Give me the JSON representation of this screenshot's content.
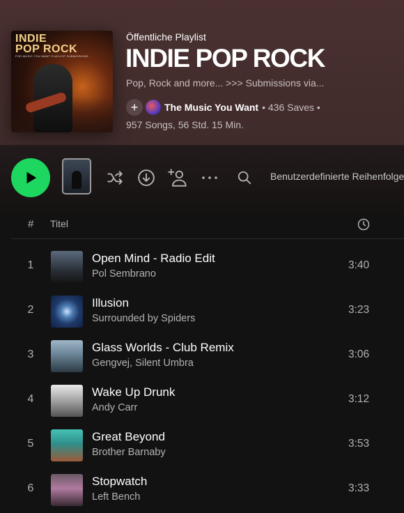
{
  "playlist": {
    "type_label": "Öffentliche Playlist",
    "title": "INDIE POP ROCK",
    "description": "Pop, Rock and more... >>> Submissions via...",
    "owner": "The Music You Want",
    "saves": "• 436 Saves •",
    "duration": "957 Songs, 56 Std. 15 Min.",
    "cover_text": "INDIE\nPOP ROCK",
    "cover_subtitle": "FOR MUSIC YOU WANT PLAYLIST SUBMISSIONS"
  },
  "actions": {
    "sort_label": "Benutzerdefinierte Reihenfolge",
    "icons": [
      "play-icon",
      "shuffle-icon",
      "download-icon",
      "add-user-icon",
      "more-icon",
      "search-icon"
    ]
  },
  "table": {
    "col_number": "#",
    "col_title": "Titel",
    "tracks": [
      {
        "num": "1",
        "title": "Open Mind - Radio Edit",
        "artist": "Pol Sembrano",
        "time": "3:40"
      },
      {
        "num": "2",
        "title": "Illusion",
        "artist": "Surrounded by Spiders",
        "time": "3:23"
      },
      {
        "num": "3",
        "title": "Glass Worlds - Club Remix",
        "artist": "Gengvej, Silent Umbra",
        "time": "3:06"
      },
      {
        "num": "4",
        "title": "Wake Up Drunk",
        "artist": "Andy Carr",
        "time": "3:12"
      },
      {
        "num": "5",
        "title": "Great Beyond",
        "artist": "Brother Barnaby",
        "time": "3:53"
      },
      {
        "num": "6",
        "title": "Stopwatch",
        "artist": "Left Bench",
        "time": "3:33"
      }
    ]
  },
  "colors": {
    "accent": "#1ed760",
    "header_bg": "#4a3130",
    "page_bg": "#121212"
  }
}
